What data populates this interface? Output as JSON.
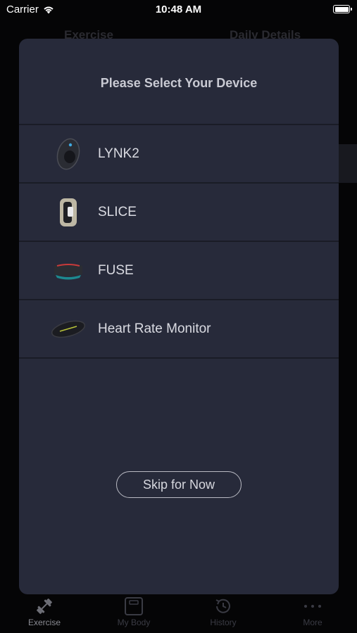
{
  "status_bar": {
    "carrier": "Carrier",
    "time": "10:48 AM"
  },
  "background": {
    "tabs": [
      "Exercise",
      "Daily Details"
    ]
  },
  "modal": {
    "title": "Please Select Your Device",
    "devices": [
      {
        "label": "LYNK2",
        "icon": "lynk2-device-icon"
      },
      {
        "label": "SLICE",
        "icon": "slice-device-icon"
      },
      {
        "label": "FUSE",
        "icon": "fuse-device-icon"
      },
      {
        "label": "Heart Rate Monitor",
        "icon": "heart-rate-monitor-icon"
      }
    ],
    "skip_label": "Skip for Now"
  },
  "tabbar": {
    "items": [
      {
        "label": "Exercise",
        "icon": "dumbbell-icon",
        "active": true
      },
      {
        "label": "My Body",
        "icon": "scale-icon",
        "active": false
      },
      {
        "label": "History",
        "icon": "history-icon",
        "active": false
      },
      {
        "label": "More",
        "icon": "more-icon",
        "active": false
      }
    ]
  },
  "colors": {
    "modal_bg": "#272a3a",
    "divider": "#1a1c26",
    "text": "#dadbe2"
  }
}
